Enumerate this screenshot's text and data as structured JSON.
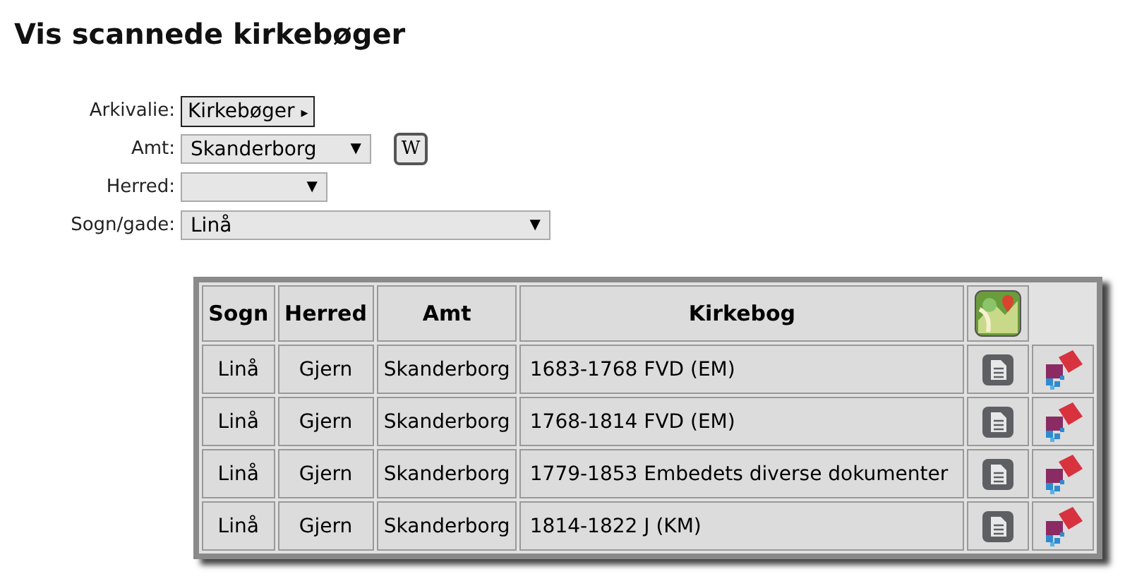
{
  "title": "Vis scannede kirkebøger",
  "form": [
    {
      "label": "Arkivalie:",
      "kind": "menu",
      "value": "Kirkebøger",
      "caret": "▸"
    },
    {
      "label": "Amt:",
      "kind": "select",
      "value": "Skanderborg",
      "caret": "▼",
      "wiki_button": "W"
    },
    {
      "label": "Herred:",
      "kind": "select",
      "caret": "▼"
    },
    {
      "label": "Sogn/gade:",
      "kind": "select",
      "value": "Linå",
      "caret": "▼"
    }
  ],
  "table": {
    "columns": [
      "Sogn",
      "Herred",
      "Amt",
      "Kirkebog"
    ],
    "rows": [
      [
        "Linå",
        "Gjern",
        "Skanderborg",
        "1683-1768 FVD (EM)"
      ],
      [
        "Linå",
        "Gjern",
        "Skanderborg",
        "1768-1814 FVD (EM)"
      ],
      [
        "Linå",
        "Gjern",
        "Skanderborg",
        "1779-1853 Embedets diverse dokumenter"
      ],
      [
        "Linå",
        "Gjern",
        "Skanderborg",
        "1814-1822 J (KM)"
      ]
    ]
  }
}
